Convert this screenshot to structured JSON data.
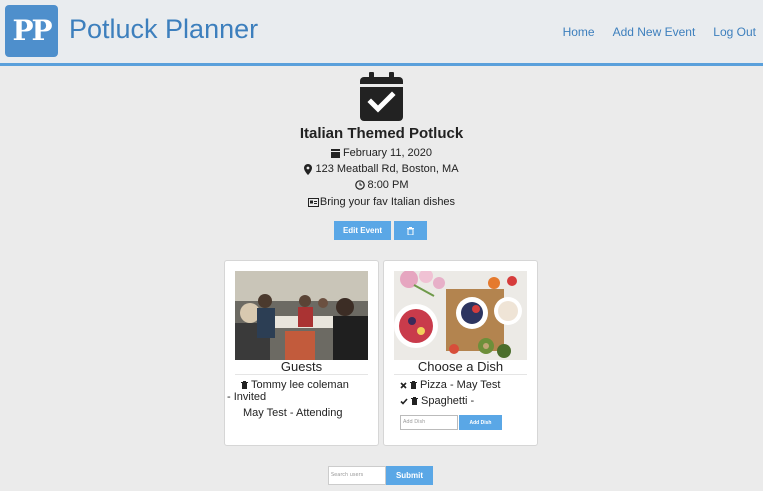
{
  "header": {
    "logo_text": "PP",
    "brand": "Potluck Planner",
    "nav": {
      "home": "Home",
      "add_event": "Add New Event",
      "logout": "Log Out"
    },
    "colors": {
      "accent": "#5aa0db",
      "brand": "#3d7fbd"
    }
  },
  "event": {
    "icon": "calendar-check-icon",
    "title": "Italian Themed Potluck",
    "date": "February 11, 2020",
    "address": "123 Meatball Rd, Boston, MA",
    "time": "8:00 PM",
    "description": "Bring your fav Italian dishes",
    "edit_label": "Edit Event",
    "delete_icon": "trash-icon"
  },
  "guests": {
    "title": "Guests",
    "items": [
      {
        "line1": "Tommy lee coleman",
        "line2": "- Invited"
      },
      {
        "line1": "May Test - Attending"
      }
    ]
  },
  "dishes": {
    "title": "Choose a Dish",
    "items": [
      {
        "status_icon": "x-icon",
        "text": "Pizza - May Test"
      },
      {
        "status_icon": "check-icon",
        "text": "Spaghetti -"
      }
    ],
    "input_placeholder": "Add Dish",
    "add_label": "Add Dish"
  },
  "search": {
    "placeholder": "Search users",
    "submit_label": "Submit"
  }
}
